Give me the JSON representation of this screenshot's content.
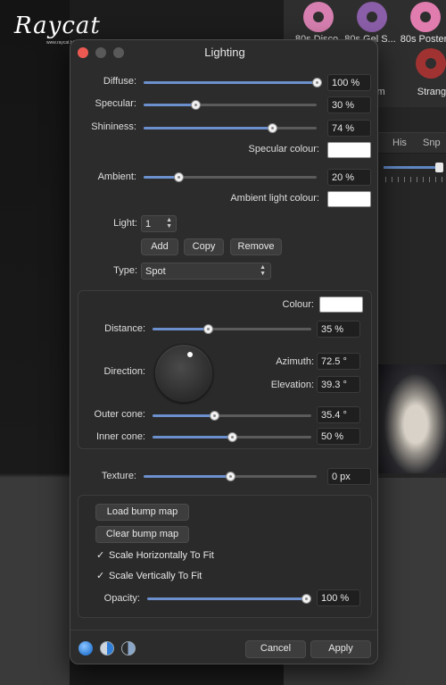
{
  "watermark": {
    "name": "Raycat",
    "sub": "www.raycat.blog"
  },
  "presets": [
    {
      "label": "80s Disco",
      "color": "#d67fb0"
    },
    {
      "label": "80s Gel S...",
      "color": "#8a5ea8"
    },
    {
      "label": "80s Poster",
      "color": "#e07cae"
    },
    {
      "label": "um",
      "color": "#7a7a7a"
    },
    {
      "label": "Strange",
      "color": "#a13232"
    }
  ],
  "right_panel": {
    "tabs": [
      "His",
      "Snp"
    ]
  },
  "dialog": {
    "title": "Lighting",
    "diffuse": {
      "label": "Diffuse:",
      "value": "100 %",
      "level": 100
    },
    "specular": {
      "label": "Specular:",
      "value": "30 %",
      "level": 30
    },
    "shininess": {
      "label": "Shininess:",
      "value": "74 %",
      "level": 74
    },
    "specular_colour": {
      "label": "Specular colour:",
      "color": "#ffffff"
    },
    "ambient": {
      "label": "Ambient:",
      "value": "20 %",
      "level": 20
    },
    "ambient_colour": {
      "label": "Ambient light colour:",
      "color": "#ffffff"
    },
    "light": {
      "label": "Light:",
      "value": "1"
    },
    "buttons": {
      "add": "Add",
      "copy": "Copy",
      "remove": "Remove"
    },
    "type": {
      "label": "Type:",
      "value": "Spot"
    },
    "spot": {
      "colour_label": "Colour:",
      "distance": {
        "label": "Distance:",
        "value": "35 %",
        "level": 35
      },
      "direction_label": "Direction:",
      "azimuth": {
        "label": "Azimuth:",
        "value": "72.5 °"
      },
      "elevation": {
        "label": "Elevation:",
        "value": "39.3 °"
      },
      "outer_cone": {
        "label": "Outer cone:",
        "value": "35.4 °",
        "level": 39
      },
      "inner_cone": {
        "label": "Inner cone:",
        "value": "50 %",
        "level": 50
      }
    },
    "texture": {
      "label": "Texture:",
      "value": "0 px",
      "level": 50
    },
    "bump": {
      "load": "Load bump map",
      "clear": "Clear bump map",
      "scale_h": {
        "label": "Scale Horizontally To Fit",
        "checked": true
      },
      "scale_v": {
        "label": "Scale Vertically To Fit",
        "checked": true
      },
      "opacity": {
        "label": "Opacity:",
        "value": "100 %",
        "level": 100
      }
    },
    "footer": {
      "cancel": "Cancel",
      "apply": "Apply"
    },
    "icons": [
      "light-blue-sphere-icon",
      "half-sphere-icon",
      "half-moon-icon"
    ]
  }
}
